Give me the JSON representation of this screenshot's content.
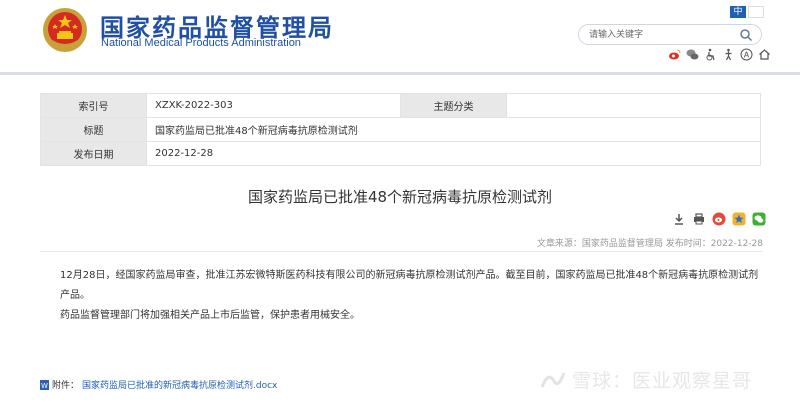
{
  "site": {
    "title_cn": "国家药品监督管理局",
    "title_en": "National Medical Products Administration"
  },
  "lang": {
    "zh": "中",
    "other": ""
  },
  "search": {
    "placeholder": "请输入关键字"
  },
  "toolbar_icons": [
    "weibo-icon",
    "wechat-icon",
    "accessibility-icon",
    "elder-mode-icon",
    "language-icon",
    "home-icon"
  ],
  "meta": {
    "index_label": "索引号",
    "index_value": "XZXK-2022-303",
    "category_label": "主题分类",
    "category_value": "",
    "title_label": "标题",
    "title_value": "国家药监局已批准48个新冠病毒抗原检测试剂",
    "date_label": "发布日期",
    "date_value": "2022-12-28"
  },
  "article": {
    "title": "国家药监局已批准48个新冠病毒抗原检测试剂",
    "source_line": "文章来源：国家药品监督管理局 发布时间：2022-12-28",
    "paragraph1": "12月28日，经国家药监局审查，批准江苏宏微特斯医药科技有限公司的新冠病毒抗原检测试剂产品。截至目前，国家药监局已批准48个新冠病毒抗原检测试剂产品。",
    "paragraph2": "药品监督管理部门将加强相关产品上市后监管，保护患者用械安全。"
  },
  "attachment": {
    "label": "附件：",
    "filename": "国家药监局已批准的新冠病毒抗原检测试剂.docx"
  },
  "watermark": {
    "text": "雪球：医业观察星哥"
  },
  "colors": {
    "brand_blue": "#1f4fa6",
    "link_blue": "#1f5fb4",
    "label_bg": "#e8e8e8"
  }
}
